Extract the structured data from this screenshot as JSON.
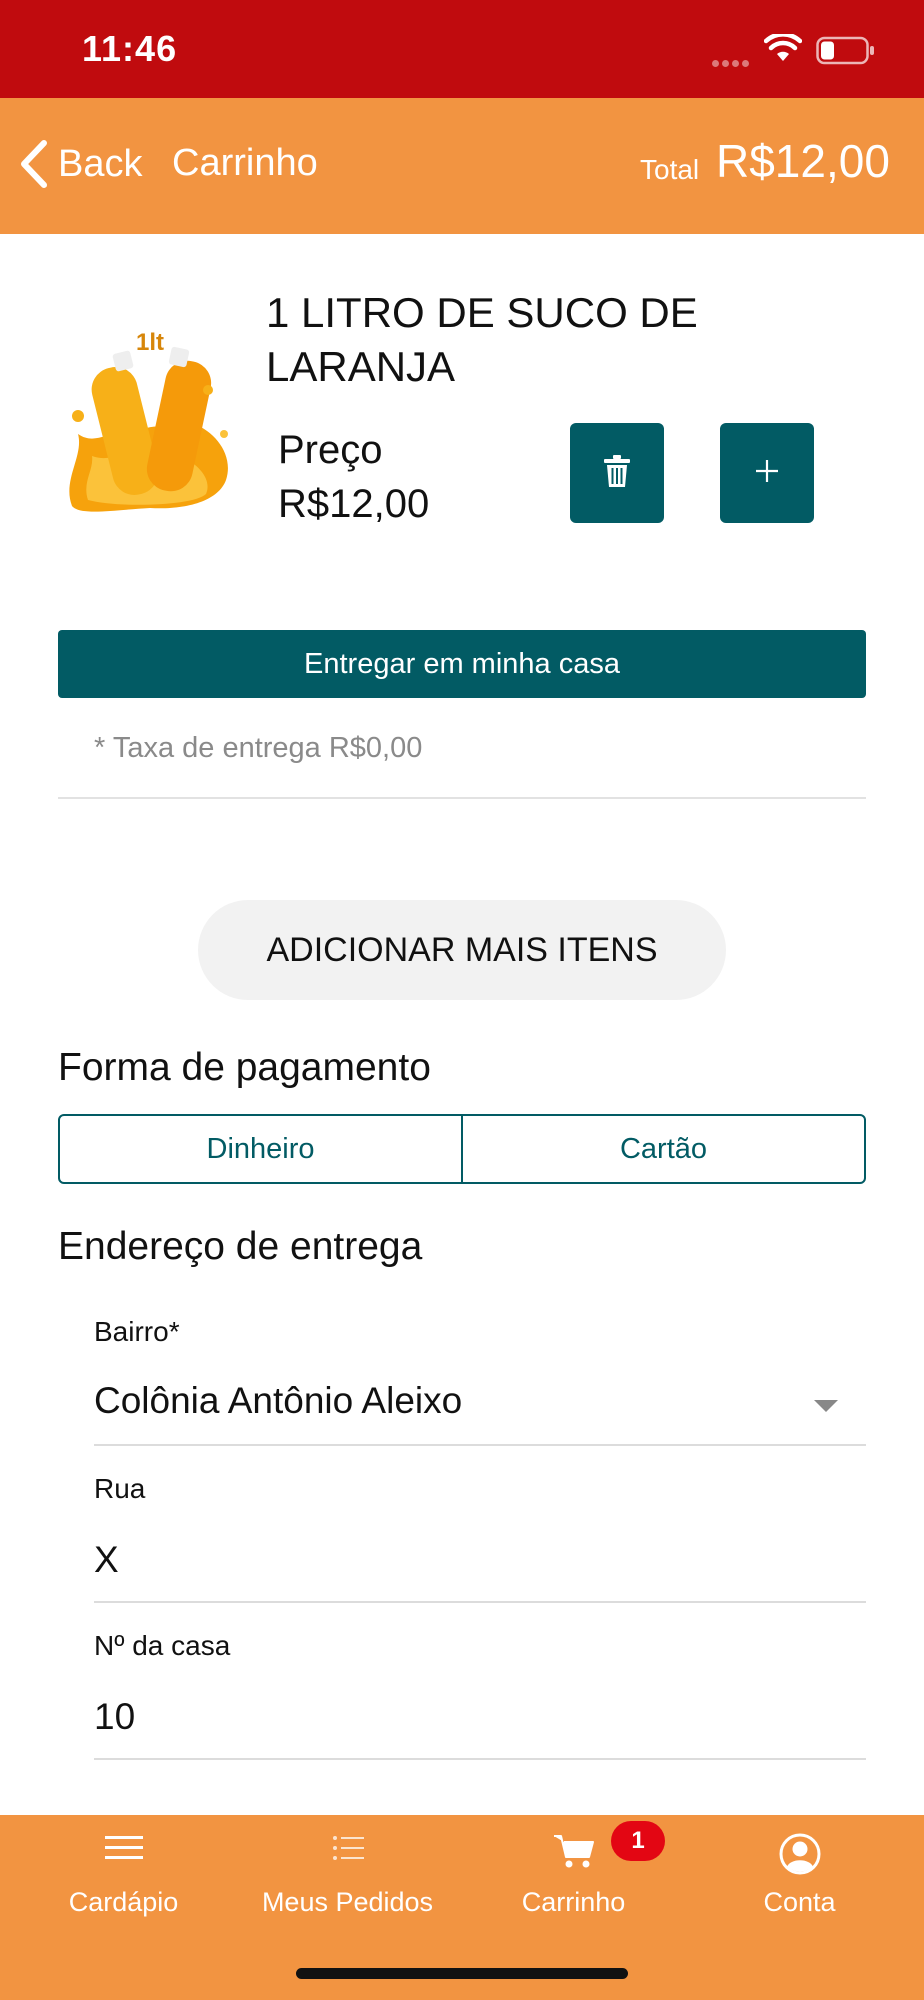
{
  "status_bar": {
    "time": "11:46"
  },
  "header": {
    "back_label": "Back",
    "title": "Carrinho",
    "total_label": "Total",
    "total_value": "R$12,00"
  },
  "product": {
    "name": "1 LITRO DE SUCO DE LARANJA",
    "image_caption": "1lt",
    "price_label": "Preço",
    "price_value": "R$12,00"
  },
  "delivery": {
    "button_label": "Entregar em minha casa",
    "fee_text": "* Taxa de entrega R$0,00"
  },
  "add_more_label": "ADICIONAR MAIS ITENS",
  "payment": {
    "title": "Forma de pagamento",
    "options": [
      "Dinheiro",
      "Cartão"
    ]
  },
  "address": {
    "title": "Endereço de entrega",
    "fields": [
      {
        "label": "Bairro*",
        "value": "Colônia Antônio Aleixo"
      },
      {
        "label": "Rua",
        "value": "X"
      },
      {
        "label": "Nº da casa",
        "value": "10"
      }
    ]
  },
  "tabs": [
    {
      "label": "Cardápio",
      "icon": "menu-icon"
    },
    {
      "label": "Meus Pedidos",
      "icon": "list-icon"
    },
    {
      "label": "Carrinho",
      "icon": "cart-icon",
      "badge": "1"
    },
    {
      "label": "Conta",
      "icon": "account-icon"
    }
  ],
  "colors": {
    "status_bar": "#c00b0e",
    "header": "#f29441",
    "accent": "#025b64",
    "badge": "#e30613"
  }
}
